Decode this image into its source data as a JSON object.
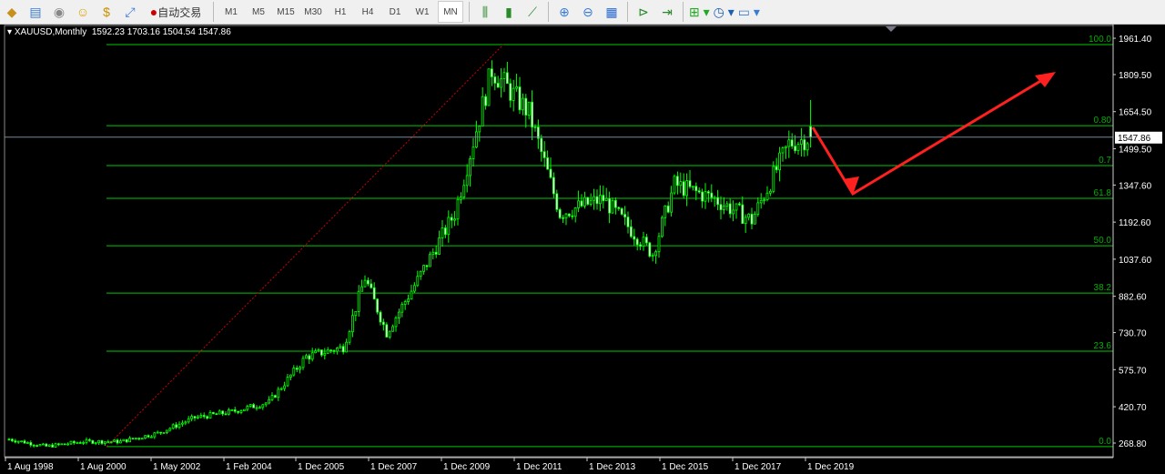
{
  "toolbar": {
    "auto_trading": "自动交易",
    "timeframes": [
      "M1",
      "M5",
      "M15",
      "M30",
      "H1",
      "H4",
      "D1",
      "W1",
      "MN"
    ],
    "active_timeframe": "MN",
    "icons": [
      "new-order-icon",
      "market-watch-icon",
      "signals-icon",
      "navigator-icon",
      "terminal-icon",
      "fullscreen-icon",
      "auto-trading-icon"
    ],
    "right_icons": [
      "bar-chart-icon",
      "candlestick-icon",
      "line-chart-icon",
      "zoom-in-icon",
      "zoom-out-icon",
      "tile-windows-icon",
      "autoscroll-icon",
      "chart-shift-icon",
      "indicators-icon",
      "periods-icon",
      "templates-icon"
    ]
  },
  "chart": {
    "symbol_info": "XAUUSD,Monthly",
    "ohlc": "1592.23 1703.16 1504.54 1547.86",
    "current_price": "1547.86",
    "colors": {
      "bull": "#00ff00",
      "bear": "#00ff00",
      "fib": "#00c800",
      "arrow": "#ff2020",
      "grid_text": "#ffffff"
    },
    "price_labels": [
      "1961.40",
      "1809.50",
      "1654.50",
      "1499.50",
      "1347.60",
      "1192.60",
      "1037.60",
      "882.60",
      "730.70",
      "575.70",
      "420.70",
      "268.80"
    ],
    "time_labels": [
      "1 Aug 1998",
      "1 Aug 2000",
      "1 May 2002",
      "1 Feb 2004",
      "1 Dec 2005",
      "1 Dec 2007",
      "1 Dec 2009",
      "1 Dec 2011",
      "1 Dec 2013",
      "1 Dec 2015",
      "1 Dec 2017",
      "1 Dec 2019"
    ],
    "fib_levels": [
      {
        "label": "100.0",
        "price": 1935
      },
      {
        "label": "0.80",
        "price": 1596
      },
      {
        "label": "0.7",
        "price": 1429
      },
      {
        "label": "61.8",
        "price": 1292
      },
      {
        "label": "50.0",
        "price": 1094
      },
      {
        "label": "38.2",
        "price": 896
      },
      {
        "label": "23.6",
        "price": 653
      },
      {
        "label": "0.0",
        "price": 254
      }
    ]
  },
  "chart_data": {
    "type": "candlestick",
    "title": "XAUUSD,Monthly",
    "ylim": [
      268.8,
      1961.4
    ],
    "anchors": [
      [
        "1998-08",
        285
      ],
      [
        "1999-08",
        255
      ],
      [
        "2000-08",
        275
      ],
      [
        "2001-08",
        275
      ],
      [
        "2002-08",
        310
      ],
      [
        "2003-08",
        375
      ],
      [
        "2004-08",
        400
      ],
      [
        "2005-08",
        440
      ],
      [
        "2006-08",
        630
      ],
      [
        "2007-08",
        670
      ],
      [
        "2008-03",
        960
      ],
      [
        "2008-10",
        730
      ],
      [
        "2009-08",
        950
      ],
      [
        "2010-08",
        1230
      ],
      [
        "2011-08",
        1830
      ],
      [
        "2012-08",
        1650
      ],
      [
        "2013-06",
        1230
      ],
      [
        "2014-08",
        1290
      ],
      [
        "2015-12",
        1060
      ],
      [
        "2016-07",
        1350
      ],
      [
        "2017-08",
        1290
      ],
      [
        "2018-08",
        1200
      ],
      [
        "2019-08",
        1520
      ],
      [
        "2020-03",
        1547.86
      ]
    ]
  }
}
